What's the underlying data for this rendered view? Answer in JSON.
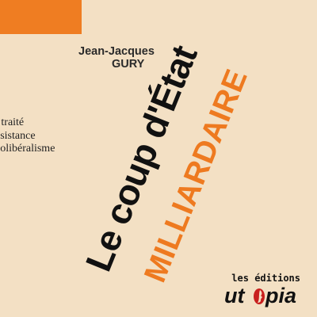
{
  "cover": {
    "author_first": "Jean-Jacques",
    "author_last": "GURY",
    "subtitle_lines": [
      "t traité",
      "ésistance",
      "éolibéralisme"
    ],
    "title_line1": "Le coup d'État",
    "title_line2": "MILLIARDAIRE",
    "publisher_small": "les éditions",
    "publisher_logo_left": "ut",
    "publisher_logo_right": "pia"
  },
  "colors": {
    "background": "#f3e0c4",
    "accent": "#ef7d22",
    "text": "#111111"
  },
  "icons": {
    "publisher_logo_mark": "red-face-profile-icon"
  }
}
